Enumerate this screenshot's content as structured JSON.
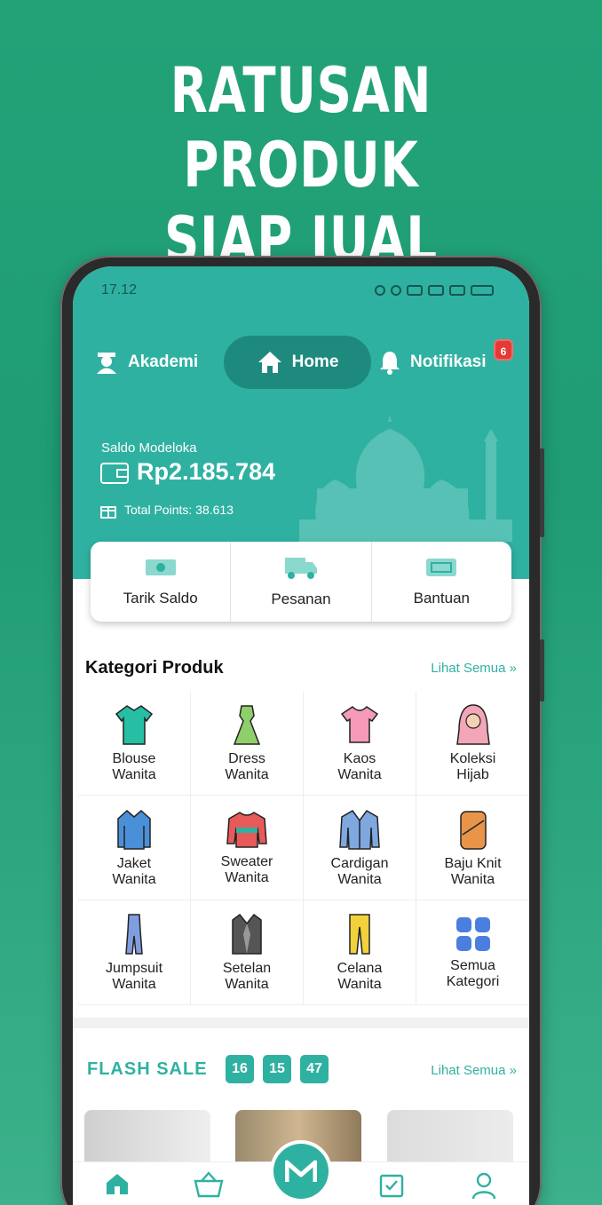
{
  "headline": {
    "line1": "RATUSAN PRODUK",
    "line2": "SIAP JUAL"
  },
  "status_bar": {
    "time": "17.12"
  },
  "nav": {
    "akademi": "Akademi",
    "home": "Home",
    "notifikasi": "Notifikasi",
    "notif_count": "6"
  },
  "wallet": {
    "label": "Saldo Modeloka",
    "amount": "Rp2.185.784",
    "points": "Total Points: 38.613"
  },
  "actions": [
    "Tarik Saldo",
    "Pesanan",
    "Bantuan"
  ],
  "categories_section": {
    "title": "Kategori Produk",
    "see_all": "Lihat Semua »",
    "items": [
      {
        "line1": "Blouse",
        "line2": "Wanita",
        "icon": "blouse-icon"
      },
      {
        "line1": "Dress",
        "line2": "Wanita",
        "icon": "dress-icon"
      },
      {
        "line1": "Kaos",
        "line2": "Wanita",
        "icon": "tshirt-icon"
      },
      {
        "line1": "Koleksi",
        "line2": "Hijab",
        "icon": "hijab-icon"
      },
      {
        "line1": "Jaket",
        "line2": "Wanita",
        "icon": "jacket-icon"
      },
      {
        "line1": "Sweater",
        "line2": "Wanita",
        "icon": "sweater-icon"
      },
      {
        "line1": "Cardigan",
        "line2": "Wanita",
        "icon": "cardigan-icon"
      },
      {
        "line1": "Baju Knit",
        "line2": "Wanita",
        "icon": "knit-icon"
      },
      {
        "line1": "Jumpsuit",
        "line2": "Wanita",
        "icon": "jumpsuit-icon"
      },
      {
        "line1": "Setelan",
        "line2": "Wanita",
        "icon": "suit-icon"
      },
      {
        "line1": "Celana",
        "line2": "Wanita",
        "icon": "pants-icon"
      },
      {
        "line1": "Semua",
        "line2": "Kategori",
        "icon": "grid-icon"
      }
    ]
  },
  "flash_sale": {
    "title": "FLASH SALE",
    "hours": "16",
    "minutes": "15",
    "seconds": "47",
    "see_all": "Lihat Semua »"
  },
  "colors": {
    "background": "#23a278",
    "accent": "#2fb1a1",
    "badge": "#e53935"
  }
}
